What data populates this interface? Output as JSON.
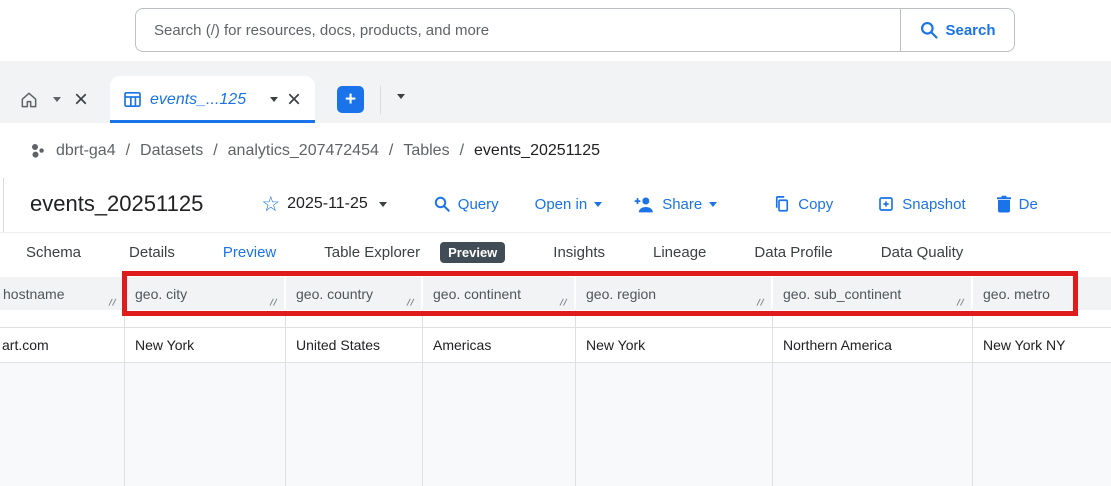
{
  "search": {
    "placeholder": "Search (/) for resources, docs, products, and more",
    "button_label": "Search"
  },
  "tab_strip": {
    "active_tab_label": "events_...125",
    "close_glyph": "×",
    "add_glyph": "+"
  },
  "breadcrumb": {
    "separator": "/",
    "items": [
      "dbrt-ga4",
      "Datasets",
      "analytics_207472454",
      "Tables",
      "events_20251125"
    ]
  },
  "toolbar": {
    "title": "events_20251125",
    "star_glyph": "☆",
    "date_label": "2025-11-25",
    "actions": {
      "query": "Query",
      "open_in": "Open in",
      "share": "Share",
      "copy": "Copy",
      "snapshot": "Snapshot",
      "delete": "De"
    }
  },
  "tabs": {
    "schema": "Schema",
    "details": "Details",
    "preview": "Preview",
    "table_explorer": "Table Explorer",
    "preview_badge": "Preview",
    "insights": "Insights",
    "lineage": "Lineage",
    "data_profile": "Data Profile",
    "data_quality": "Data Quality"
  },
  "table": {
    "columns": [
      "hostname",
      "geo. city",
      "geo. country",
      "geo. continent",
      "geo. region",
      "geo. sub_continent",
      "geo. metro"
    ],
    "rows": [
      [
        "art.com",
        "New York",
        "United States",
        "Americas",
        "New York",
        "Northern America",
        "New York NY"
      ]
    ]
  },
  "colors": {
    "accent_blue": "#1a73e8",
    "highlight_red": "#e01b1b",
    "badge_bg": "#414d56",
    "header_bg": "#f1f3f4"
  }
}
